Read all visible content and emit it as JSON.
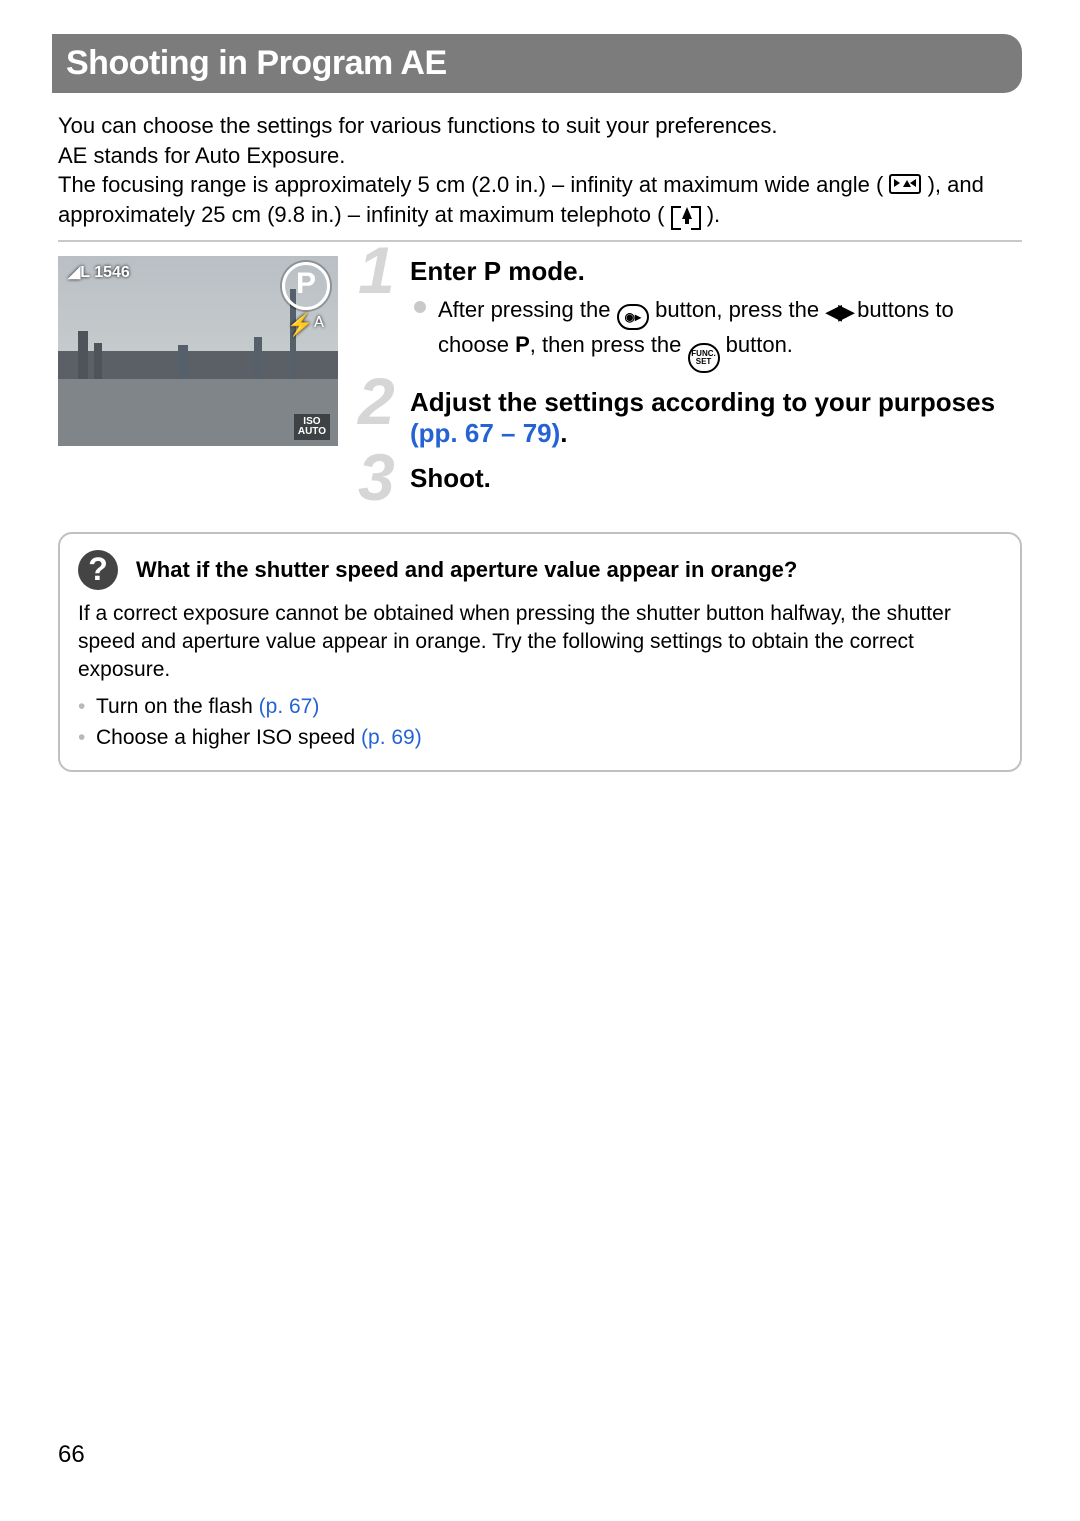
{
  "page_number": "66",
  "title": "Shooting in Program AE",
  "intro": {
    "p1": "You can choose the settings for various functions to suit your preferences.",
    "p2": "AE stands for Auto Exposure.",
    "p3a": "The focusing range is approximately 5 cm (2.0 in.) – infinity at maximum wide angle (",
    "p3b": "), and approximately 25 cm (9.8 in.) – infinity at maximum telephoto (",
    "p3c": ")."
  },
  "lcd": {
    "mode_letter": "P",
    "count": "1546",
    "flash_indicator": "⚡ᴬ",
    "iso_line1": "ISO",
    "iso_line2": "AUTO"
  },
  "steps": [
    {
      "num": "1",
      "title_pre": "Enter ",
      "title_icon": "P",
      "title_post": " mode.",
      "body_a": "After pressing the ",
      "mode_btn": "◉▸",
      "body_b": " button, press the ",
      "arrows": "◀▶",
      "body_c": " buttons to choose ",
      "p_icon": "P",
      "body_d": ", then press the ",
      "func_top": "FUNC.",
      "func_bot": "SET",
      "body_e": " button."
    },
    {
      "num": "2",
      "title_pre": "Adjust the settings according to your purposes ",
      "link": "(pp. 67 – 79)",
      "title_post": "."
    },
    {
      "num": "3",
      "title_pre": "Shoot."
    }
  ],
  "faq": {
    "icon": "?",
    "title": "What if the shutter speed and aperture value appear in orange?",
    "body": "If a correct exposure cannot be obtained when pressing the shutter button halfway, the shutter speed and aperture value appear in orange. Try the following settings to obtain the correct exposure.",
    "items": [
      {
        "text": "Turn on the flash ",
        "link": "(p. 67)"
      },
      {
        "text": "Choose a higher ISO speed ",
        "link": "(p. 69)"
      }
    ]
  }
}
